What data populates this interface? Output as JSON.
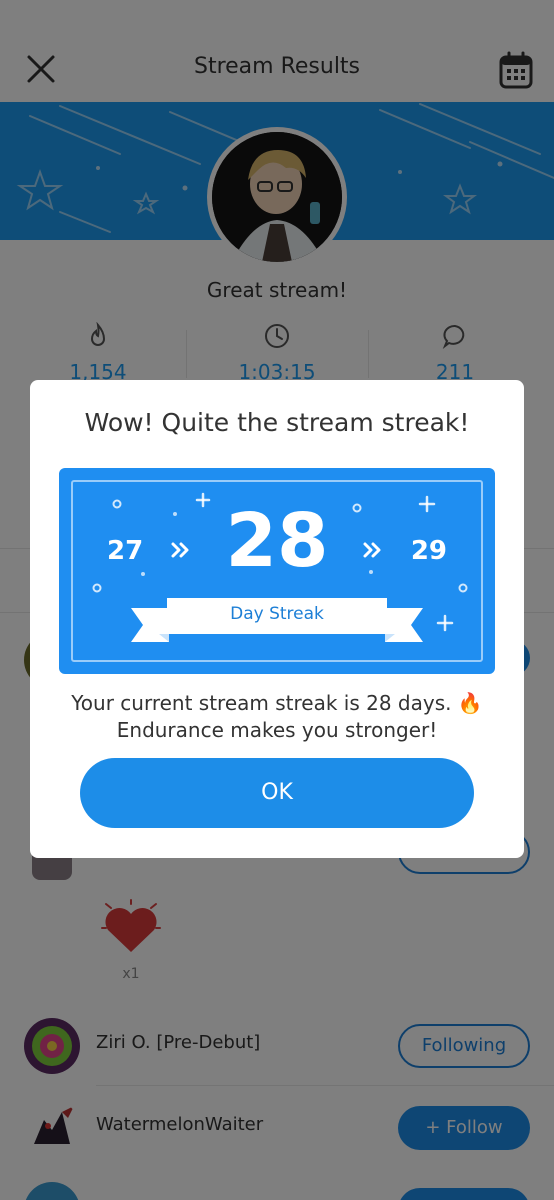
{
  "header": {
    "title": "Stream Results",
    "close_icon": "close-icon",
    "calendar_icon": "calendar-icon"
  },
  "summary": {
    "headline": "Great stream!",
    "stats": [
      {
        "icon": "flame-icon",
        "value": "1,154"
      },
      {
        "icon": "clock-icon",
        "value": "1:03:15"
      },
      {
        "icon": "chat-bubble-icon",
        "value": "211"
      }
    ]
  },
  "gifts": [
    {
      "icon": "heart-icon",
      "count": "x1"
    }
  ],
  "viewers": [
    {
      "name": "Ziri O. [Pre-Debut]",
      "button": "Following"
    },
    {
      "name": "WatermelonWaiter",
      "button": "+ Follow"
    }
  ],
  "modal": {
    "title": "Wow! Quite the stream streak!",
    "streak": {
      "previous": "27",
      "current": "28",
      "next": "29",
      "label": "Day Streak"
    },
    "message_line1": "Your current stream streak is 28 days. 🔥",
    "message_line2": "Endurance makes you stronger!",
    "ok_label": "OK"
  },
  "colors": {
    "accent": "#1d8de8",
    "banner": "#1d9bf0",
    "streak_card": "#1f8ef1"
  }
}
